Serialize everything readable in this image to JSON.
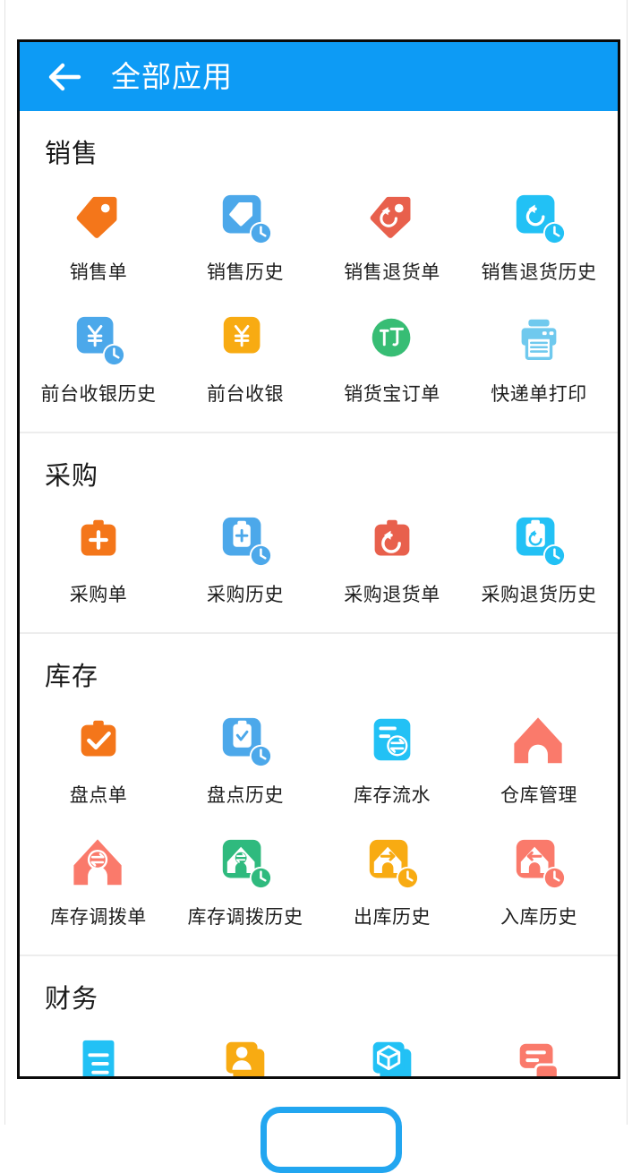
{
  "appbar": {
    "title": "全部应用",
    "back_icon": "arrow-left-icon",
    "bg_color": "#0d9bf5",
    "title_color": "#ffffff"
  },
  "colors": {
    "orange": "#f4761a",
    "blue": "#4ca8ea",
    "red": "#e8604c",
    "cyan": "#22c1f5",
    "yellow": "#f8ab12",
    "green": "#37bd74",
    "light_blue": "#6fc9ee",
    "salmon": "#fa7a6b",
    "green_mid": "#2fba7e"
  },
  "sections": [
    {
      "title": "销售",
      "items": [
        {
          "label": "销售单",
          "icon": "tag-icon",
          "color": "#f4761a",
          "shape": "tag",
          "badge": "none"
        },
        {
          "label": "销售历史",
          "icon": "tag-history-icon",
          "color": "#4ca8ea",
          "shape": "square-tag",
          "badge": "clock"
        },
        {
          "label": "销售退货单",
          "icon": "tag-return-icon",
          "color": "#e8604c",
          "shape": "tag-return",
          "badge": "none"
        },
        {
          "label": "销售退货历史",
          "icon": "tag-return-history-icon",
          "color": "#22c1f5",
          "shape": "square-return",
          "badge": "clock"
        },
        {
          "label": "前台收银历史",
          "icon": "cashier-history-icon",
          "color": "#4ca8ea",
          "shape": "square-yen",
          "badge": "clock"
        },
        {
          "label": "前台收银",
          "icon": "cashier-icon",
          "color": "#f8ab12",
          "shape": "square-yen",
          "badge": "none"
        },
        {
          "label": "销货宝订单",
          "icon": "order-circle-icon",
          "color": "#37bd74",
          "shape": "circle-ding",
          "badge": "none"
        },
        {
          "label": "快递单打印",
          "icon": "printer-icon",
          "color": "#6fc9ee",
          "shape": "printer",
          "badge": "none"
        }
      ]
    },
    {
      "title": "采购",
      "items": [
        {
          "label": "采购单",
          "icon": "case-plus-icon",
          "color": "#f4761a",
          "shape": "case-plus",
          "badge": "none"
        },
        {
          "label": "采购历史",
          "icon": "case-plus-history-icon",
          "color": "#4ca8ea",
          "shape": "square-case-plus",
          "badge": "clock"
        },
        {
          "label": "采购退货单",
          "icon": "case-return-icon",
          "color": "#e8604c",
          "shape": "case-return",
          "badge": "none"
        },
        {
          "label": "采购退货历史",
          "icon": "case-return-history-icon",
          "color": "#22c1f5",
          "shape": "square-case-return",
          "badge": "clock"
        }
      ]
    },
    {
      "title": "库存",
      "items": [
        {
          "label": "盘点单",
          "icon": "case-check-icon",
          "color": "#f4761a",
          "shape": "case-check",
          "badge": "none"
        },
        {
          "label": "盘点历史",
          "icon": "case-check-history-icon",
          "color": "#4ca8ea",
          "shape": "square-case-check",
          "badge": "clock"
        },
        {
          "label": "库存流水",
          "icon": "stock-flow-icon",
          "color": "#22c1f5",
          "shape": "doc-flow",
          "badge": "none"
        },
        {
          "label": "仓库管理",
          "icon": "warehouse-icon",
          "color": "#fa7a6b",
          "shape": "house",
          "badge": "none"
        },
        {
          "label": "库存调拨单",
          "icon": "transfer-icon",
          "color": "#fa7a6b",
          "shape": "house-swap",
          "badge": "none"
        },
        {
          "label": "库存调拨历史",
          "icon": "transfer-history-icon",
          "color": "#2fba7e",
          "shape": "square-house-swap",
          "badge": "clock"
        },
        {
          "label": "出库历史",
          "icon": "outbound-history-icon",
          "color": "#f8ab12",
          "shape": "square-house-right",
          "badge": "clock"
        },
        {
          "label": "入库历史",
          "icon": "inbound-history-icon",
          "color": "#fa7a6b",
          "shape": "square-house-left",
          "badge": "clock"
        }
      ]
    },
    {
      "title": "财务",
      "items": [
        {
          "label": "",
          "icon": "receipt-icon",
          "color": "#22c1f5",
          "shape": "receipt",
          "badge": "none"
        },
        {
          "label": "",
          "icon": "contact-icon",
          "color": "#f8ab12",
          "shape": "card-stack",
          "badge": "none"
        },
        {
          "label": "",
          "icon": "product-icon",
          "color": "#22c1f5",
          "shape": "box-stack",
          "badge": "none"
        },
        {
          "label": "",
          "icon": "message-icon",
          "color": "#fa7a6b",
          "shape": "chat",
          "badge": "none"
        }
      ]
    }
  ]
}
